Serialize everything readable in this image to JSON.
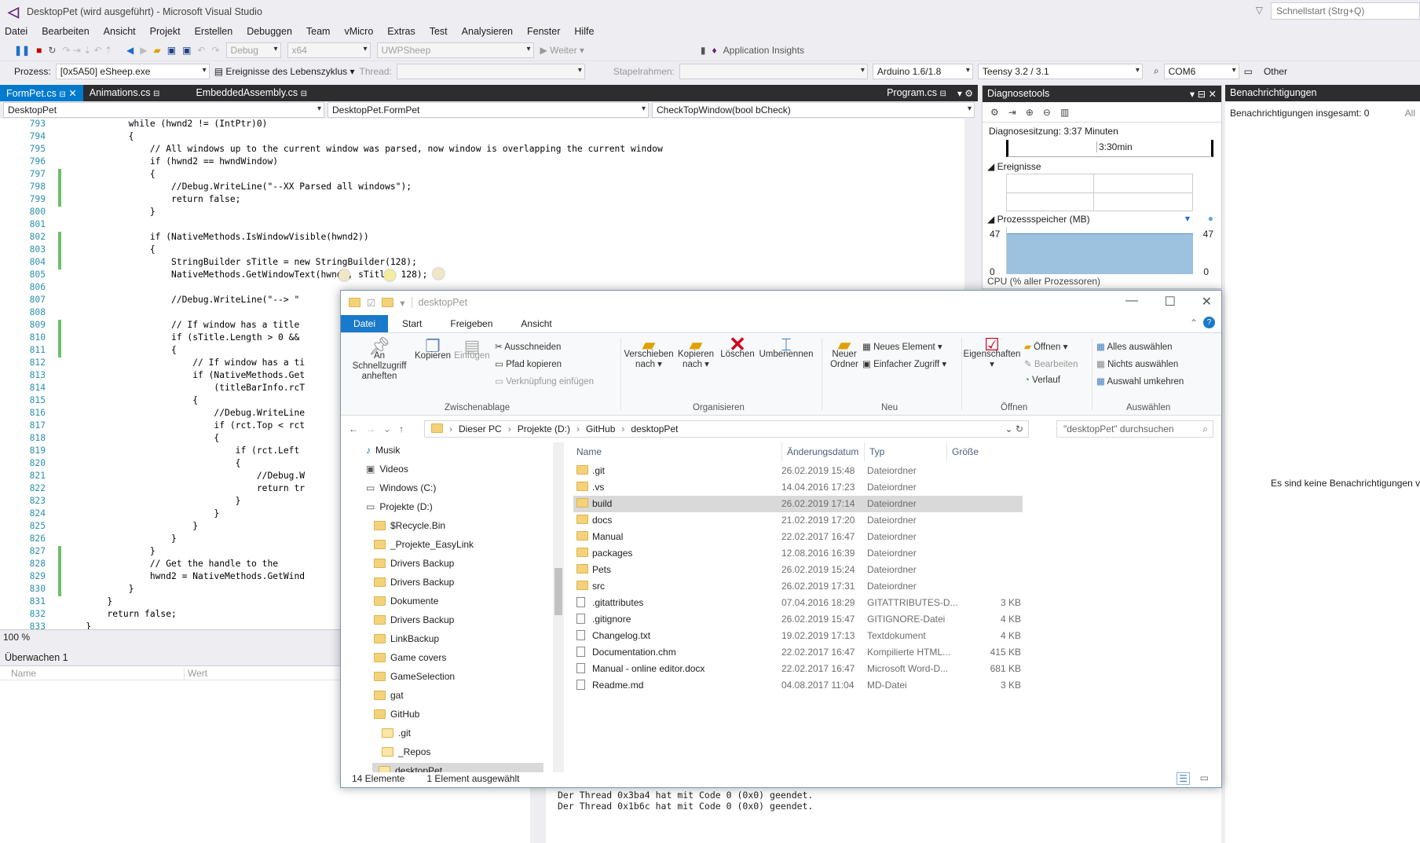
{
  "vs": {
    "title": "DesktopPet (wird ausgeführt) - Microsoft Visual Studio",
    "quicklaunch": "Schnellstart (Strg+Q)",
    "menu": [
      "Datei",
      "Bearbeiten",
      "Ansicht",
      "Projekt",
      "Erstellen",
      "Debuggen",
      "Team",
      "vMicro",
      "Extras",
      "Test",
      "Analysieren",
      "Fenster",
      "Hilfe"
    ],
    "toolbar": {
      "config": "Debug",
      "platform": "x64",
      "project": "UWPSheep",
      "continue": "Weiter",
      "insights": "Application Insights"
    },
    "toolbar2": {
      "process_label": "Prozess:",
      "process": "[0x5A50] eSheep.exe",
      "lifecycle": "Ereignisse des Lebenszyklus",
      "thread_label": "Thread:",
      "stack_label": "Stapelrahmen:",
      "board": "Arduino 1.6/1.8",
      "teensy": "Teensy 3.2 / 3.1",
      "com": "COM6",
      "other": "Other"
    },
    "tabs": [
      "FormPet.cs",
      "Animations.cs",
      "EmbeddedAssembly.cs",
      "Program.cs"
    ],
    "nav": {
      "project": "DesktopPet",
      "class": "DesktopPet.FormPet",
      "method": "CheckTopWindow(bool bCheck)"
    },
    "zoom": "100 %",
    "code_lines": [
      {
        "n": "793",
        "t": "            while (hwnd2 != (IntPtr)0)"
      },
      {
        "n": "794",
        "t": "            {"
      },
      {
        "n": "795",
        "t": "                // All windows up to the current window was parsed, now window is overlapping the current window"
      },
      {
        "n": "796",
        "t": "                if (hwnd2 == hwndWindow)"
      },
      {
        "n": "797",
        "t": "                {"
      },
      {
        "n": "798",
        "t": "                    //Debug.WriteLine(\"--XX Parsed all windows\");"
      },
      {
        "n": "799",
        "t": "                    return false;"
      },
      {
        "n": "800",
        "t": "                }"
      },
      {
        "n": "801",
        "t": ""
      },
      {
        "n": "802",
        "t": "                if (NativeMethods.IsWindowVisible(hwnd2))"
      },
      {
        "n": "803",
        "t": "                {"
      },
      {
        "n": "804",
        "t": "                    StringBuilder sTitle = new StringBuilder(128);"
      },
      {
        "n": "805",
        "t": "                    NativeMethods.GetWindowText(hwnd2, sTitle, 128);"
      },
      {
        "n": "806",
        "t": ""
      },
      {
        "n": "807",
        "t": "                    //Debug.WriteLine(\"--> \""
      },
      {
        "n": "808",
        "t": ""
      },
      {
        "n": "809",
        "t": "                    // If window has a title"
      },
      {
        "n": "810",
        "t": "                    if (sTitle.Length > 0 &&"
      },
      {
        "n": "811",
        "t": "                    {"
      },
      {
        "n": "812",
        "t": "                        // If window has a ti"
      },
      {
        "n": "813",
        "t": "                        if (NativeMethods.Get"
      },
      {
        "n": "814",
        "t": "                            (titleBarInfo.rcT"
      },
      {
        "n": "815",
        "t": "                        {"
      },
      {
        "n": "816",
        "t": "                            //Debug.WriteLine"
      },
      {
        "n": "817",
        "t": "                            if (rct.Top < rct"
      },
      {
        "n": "818",
        "t": "                            {"
      },
      {
        "n": "819",
        "t": "                                if (rct.Left"
      },
      {
        "n": "820",
        "t": "                                {"
      },
      {
        "n": "821",
        "t": "                                    //Debug.W"
      },
      {
        "n": "822",
        "t": "                                    return tr"
      },
      {
        "n": "823",
        "t": "                                }"
      },
      {
        "n": "824",
        "t": "                            }"
      },
      {
        "n": "825",
        "t": "                        }"
      },
      {
        "n": "826",
        "t": "                    }"
      },
      {
        "n": "827",
        "t": "                }"
      },
      {
        "n": "828",
        "t": "                // Get the handle to the"
      },
      {
        "n": "829",
        "t": "                hwnd2 = NativeMethods.GetWind"
      },
      {
        "n": "830",
        "t": "            }"
      },
      {
        "n": "831",
        "t": "        }"
      },
      {
        "n": "832",
        "t": "        return false;"
      },
      {
        "n": "833",
        "t": "    }"
      }
    ],
    "diag": {
      "title": "Diagnosetools",
      "session": "Diagnosesitzung: 3:37 Minuten",
      "time_mark": "3:30min",
      "events": "Ereignisse",
      "memory": "Prozessspeicher (MB)",
      "mem_max": "47",
      "mem_min": "0",
      "mem_max_r": "47",
      "mem_min_r": "0",
      "cpu": "CPU (% aller Prozessoren)"
    },
    "notif": {
      "title": "Benachrichtigungen",
      "count": "Benachrichtigungen insgesamt: 0",
      "all": "All",
      "empty": "Es sind keine Benachrichtigungen ve"
    },
    "watch": {
      "title": "Überwachen 1",
      "col_name": "Name",
      "col_value": "Wert"
    },
    "output_lines": [
      "Der Thread 0x3ba4 hat mit Code 0 (0x0) geendet.",
      "Der Thread 0x1b6c hat mit Code 0 (0x0) geendet."
    ]
  },
  "explorer": {
    "title": "desktopPet",
    "tabs": [
      "Datei",
      "Start",
      "Freigeben",
      "Ansicht"
    ],
    "ribbon": {
      "pin": "An Schnellzugriff anheften",
      "copy": "Kopieren",
      "paste": "Einfügen",
      "cut": "Ausschneiden",
      "copy_path": "Pfad kopieren",
      "paste_link": "Verknüpfung einfügen",
      "clipboard": "Zwischenablage",
      "move_to": "Verschieben nach",
      "copy_to": "Kopieren nach",
      "delete": "Löschen",
      "rename": "Umbenennen",
      "organize": "Organisieren",
      "new_folder": "Neuer Ordner",
      "new_item": "Neues Element",
      "easy_access": "Einfacher Zugriff",
      "new": "Neu",
      "properties": "Eigenschaften",
      "open": "Öffnen",
      "edit": "Bearbeiten",
      "history": "Verlauf",
      "open_grp": "Öffnen",
      "select_all": "Alles auswählen",
      "select_none": "Nichts auswählen",
      "invert": "Auswahl umkehren",
      "select": "Auswählen"
    },
    "path": [
      "Dieser PC",
      "Projekte (D:)",
      "GitHub",
      "desktopPet"
    ],
    "search": "\"desktopPet\" durchsuchen",
    "tree": [
      "Musik",
      "Videos",
      "Windows (C:)",
      "Projekte (D:)",
      "$Recycle.Bin",
      "_Projekte_EasyLink",
      "Drivers Backup",
      "Drivers Backup",
      "Dokumente",
      "Drivers Backup",
      "LinkBackup",
      "Game covers",
      "GameSelection",
      "gat",
      "GitHub",
      ".git",
      "_Repos",
      "desktopPet"
    ],
    "columns": [
      "Name",
      "Änderungsdatum",
      "Typ",
      "Größe"
    ],
    "files": [
      {
        "name": ".git",
        "date": "26.02.2019 15:48",
        "type": "Dateiordner",
        "size": ""
      },
      {
        "name": ".vs",
        "date": "14.04.2016 17:23",
        "type": "Dateiordner",
        "size": ""
      },
      {
        "name": "build",
        "date": "26.02.2019 17:14",
        "type": "Dateiordner",
        "size": ""
      },
      {
        "name": "docs",
        "date": "21.02.2019 17:20",
        "type": "Dateiordner",
        "size": ""
      },
      {
        "name": "Manual",
        "date": "22.02.2017 16:47",
        "type": "Dateiordner",
        "size": ""
      },
      {
        "name": "packages",
        "date": "12.08.2016 16:39",
        "type": "Dateiordner",
        "size": ""
      },
      {
        "name": "Pets",
        "date": "26.02.2019 15:24",
        "type": "Dateiordner",
        "size": ""
      },
      {
        "name": "src",
        "date": "26.02.2019 17:31",
        "type": "Dateiordner",
        "size": ""
      },
      {
        "name": ".gitattributes",
        "date": "07.04.2016 18:29",
        "type": "GITATTRIBUTES-D...",
        "size": "3 KB"
      },
      {
        "name": ".gitignore",
        "date": "26.02.2019 15:47",
        "type": "GITIGNORE-Datei",
        "size": "4 KB"
      },
      {
        "name": "Changelog.txt",
        "date": "19.02.2019 17:13",
        "type": "Textdokument",
        "size": "4 KB"
      },
      {
        "name": "Documentation.chm",
        "date": "22.02.2017 16:47",
        "type": "Kompilierte HTML...",
        "size": "415 KB"
      },
      {
        "name": "Manual - online editor.docx",
        "date": "22.02.2017 16:47",
        "type": "Microsoft Word-D...",
        "size": "681 KB"
      },
      {
        "name": "Readme.md",
        "date": "04.08.2017 11:04",
        "type": "MD-Datei",
        "size": "3 KB"
      }
    ],
    "status_count": "14 Elemente",
    "status_sel": "1 Element ausgewählt"
  }
}
